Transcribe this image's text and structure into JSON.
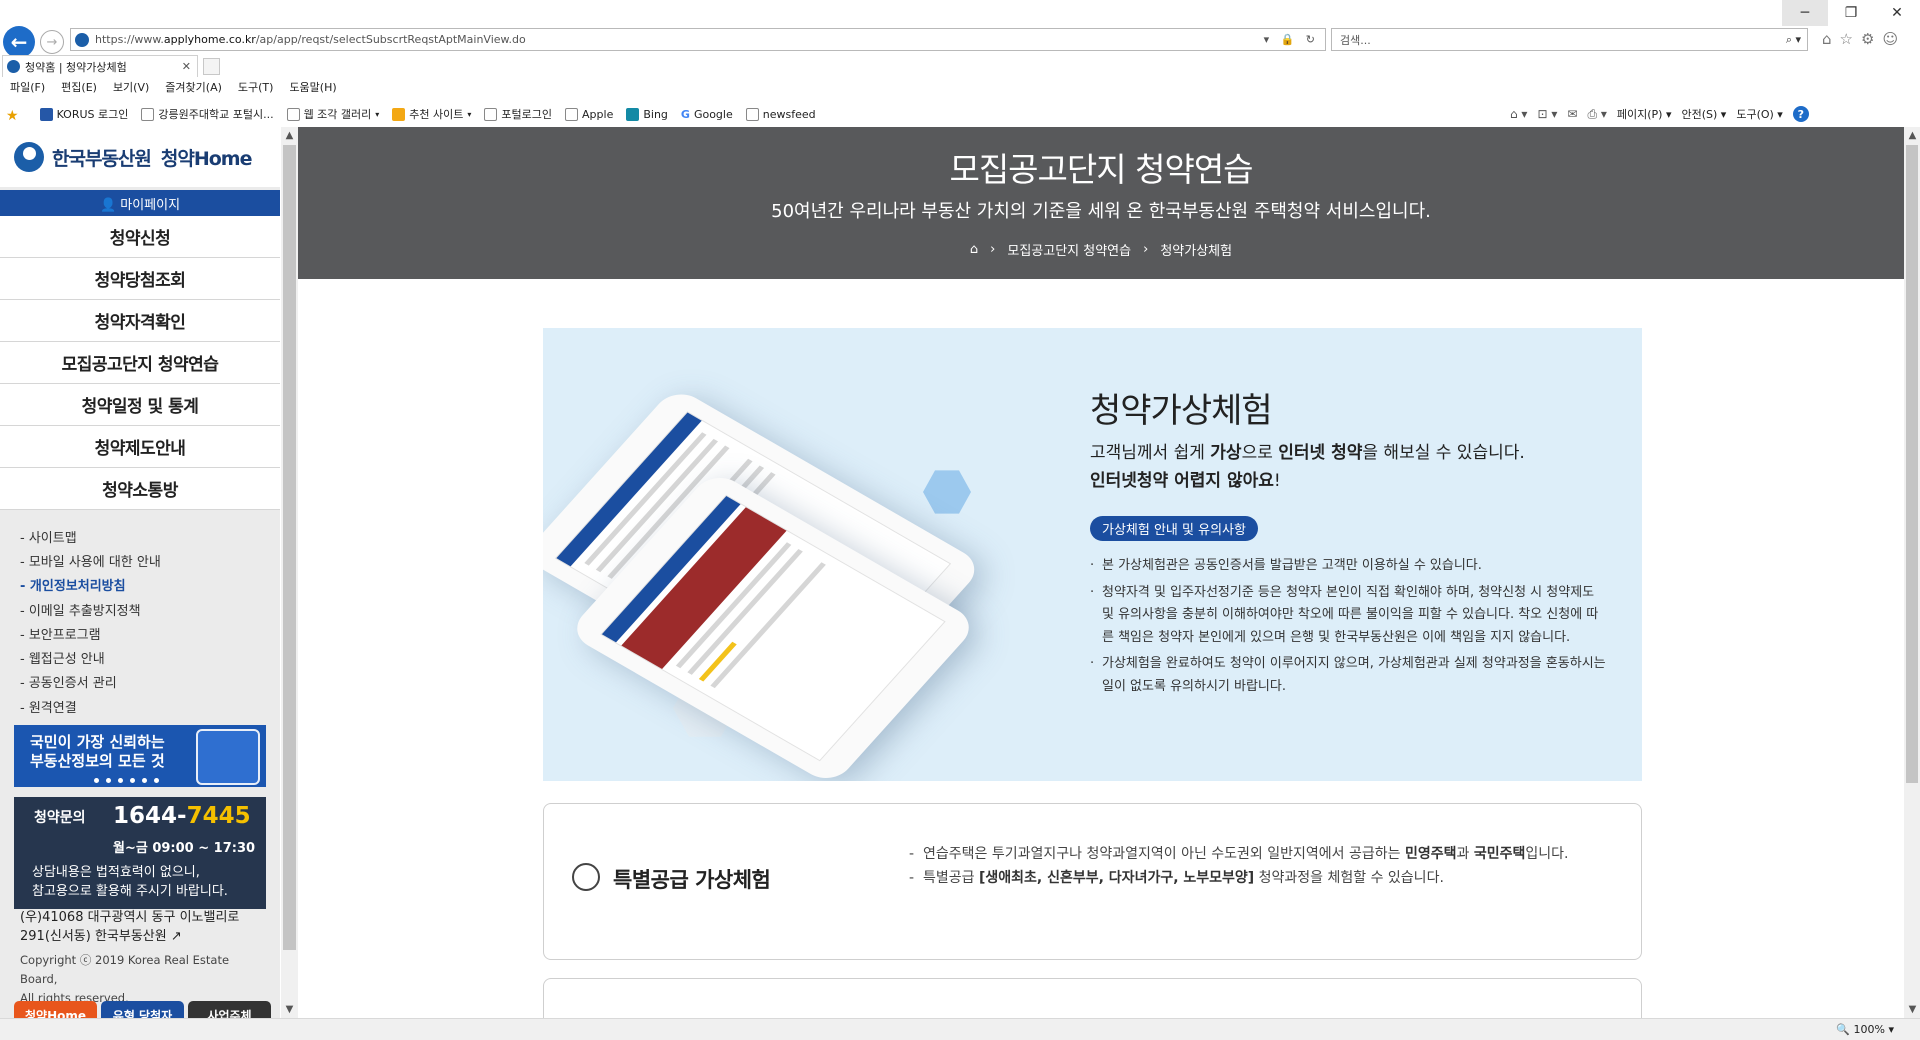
{
  "browser": {
    "window_controls": {
      "minimize": "─",
      "restore": "❐",
      "close": "✕"
    },
    "back_glyph": "←",
    "forward_glyph": "→",
    "address": {
      "protocol": "https://www.",
      "domain": "applyhome.co.kr",
      "path": "/ap/app/reqst/selectSubscrtReqstAptMainView.do",
      "icons": "▾ 🔒 ↻"
    },
    "search": {
      "placeholder": "검색...",
      "icon": "⌕ ▾"
    },
    "toolbar_icons": [
      "⌂",
      "☆",
      "⚙",
      "☺"
    ],
    "tab": {
      "title": "청약홈 | 청약가상체험",
      "close": "✕"
    },
    "menu": [
      "파일(F)",
      "편집(E)",
      "보기(V)",
      "즐겨찾기(A)",
      "도구(T)",
      "도움말(H)"
    ],
    "favorites": [
      {
        "label": "KORUS 로그인",
        "icon": "blue"
      },
      {
        "label": "강릉원주대학교 포털시...",
        "icon": "page"
      },
      {
        "label": "웹 조각 갤러리",
        "icon": "page",
        "dropdown": "▾"
      },
      {
        "label": "추천 사이트",
        "icon": "orange",
        "dropdown": "▾"
      },
      {
        "label": "포털로그인",
        "icon": "page"
      },
      {
        "label": "Apple",
        "icon": "page"
      },
      {
        "label": "Bing",
        "icon": "bing"
      },
      {
        "label": "Google",
        "icon": "google",
        "glyph": "G"
      },
      {
        "label": "newsfeed",
        "icon": "page"
      }
    ],
    "command_bar": {
      "home_icon": "⌂ ▾",
      "feed_icon": "⊡ ▾",
      "mail_icon": "✉",
      "print_icon": "⎙ ▾",
      "page": "페이지(P) ▾",
      "safety": "안전(S) ▾",
      "tools": "도구(O) ▾",
      "help": "?"
    },
    "zoom": "🔍 100%  ▾"
  },
  "sidebar": {
    "logo": {
      "name": "한국부동산원",
      "service": "청약Home"
    },
    "mypage": "👤 마이페이지",
    "main_menu": [
      "청약신청",
      "청약당첨조회",
      "청약자격확인",
      "모집공고단지 청약연습",
      "청약일정 및 통계",
      "청약제도안내",
      "청약소통방"
    ],
    "sub_menu": [
      "- 사이트맵",
      "- 모바일 사용에 대한 안내",
      "- 개인정보처리방침",
      "- 이메일 추출방지정책",
      "- 보안프로그램",
      "- 웹접근성 안내",
      "- 공동인증서 관리",
      "- 원격연결"
    ],
    "sub_menu_active": 2,
    "banner": {
      "line1": "국민이 가장 신뢰하는",
      "line2": "부동산정보의 모든 것"
    },
    "contact": {
      "label": "청약문의",
      "phone_prefix": "1644-",
      "phone_suffix": "7445",
      "hours": "월~금 09:00 ~ 17:30",
      "note1": "상담내용은 법적효력이 없으니,",
      "note2": "참고용으로 활용해 주시기 바랍니다."
    },
    "address": {
      "line1": "(우)41068 대구광역시 동구 이노밸리로",
      "line2": "291(신서동) 한국부동산원 ↗"
    },
    "copyright": {
      "line1": "Copyright ⓒ 2019 Korea Real Estate Board,",
      "line2": "All rights reserved."
    },
    "bottom_buttons": [
      {
        "label": "청약Home",
        "color": "#e8561c"
      },
      {
        "label": "유형 당첨자",
        "color": "#1b4ea0"
      },
      {
        "label": "사업주체",
        "color": "#333333"
      }
    ]
  },
  "hero": {
    "title": "모집공고단지 청약연습",
    "subtitle": "50여년간 우리나라 부동산 가치의 기준을 세워 온 한국부동산원 주택청약 서비스입니다.",
    "breadcrumb": [
      "모집공고단지 청약연습",
      "청약가상체험"
    ]
  },
  "visual": {
    "title": "청약가상체험",
    "desc_line1": {
      "pre": "고객님께서 쉽게 ",
      "b1": "가상",
      "mid": "으로 ",
      "b2": "인터넷 청약",
      "post": "을 해보실 수 있습니다."
    },
    "desc_line2": {
      "b": "인터넷청약 어렵지 않아요",
      "post": "!"
    },
    "pill": "가상체험 안내 및 유의사항",
    "notes": [
      "본 가상체험관은 공동인증서를 발급받은 고객만 이용하실 수 있습니다.",
      "청약자격 및 입주자선정기준 등은 청약자 본인이 직접 확인해야 하며, 청약신청 시 청약제도 및 유의사항을 충분히 이해하여야만 착오에 따른 불이익을 피할 수 있습니다. 착오 신청에 따른 책임은 청약자 본인에게 있으며 은행 및 한국부동산원은 이에 책임을 지지 않습니다.",
      "가상체험을 완료하여도 청약이 이루어지지 않으며, 가상체험관과 실제 청약과정을 혼동하시는 일이 없도록 유의하시기 바랍니다."
    ]
  },
  "card_special": {
    "title": "특별공급 가상체험",
    "desc1": {
      "pre": "연습주택은 투기과열지구나 청약과열지역이 아닌 수도권외 일반지역에서 공급하는 ",
      "b": "민영주택",
      "mid": "과 ",
      "b2": "국민주택",
      "post": "입니다."
    },
    "desc2": {
      "pre": "특별공급 ",
      "b": "[생애최초, 신혼부부, 다자녀가구, 노부모부양]",
      "post": " 청약과정을 체험할 수 있습니다."
    }
  }
}
